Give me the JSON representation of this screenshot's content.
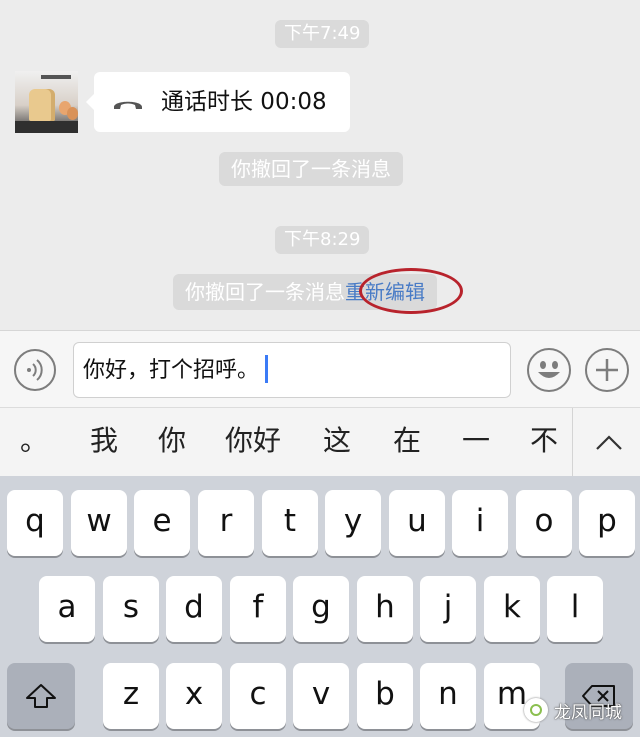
{
  "chat": {
    "time1": "下午7:49",
    "call_text": "通话时长 00:08",
    "recall1": "你撤回了一条消息",
    "time2": "下午8:29",
    "recall2": "你撤回了一条消息",
    "reedit_label": "重新编辑",
    "highlight_color": "#b8232c",
    "link_color": "#4a7cc6"
  },
  "input": {
    "value": "你好，打个招呼。",
    "voice_icon": "voice-icon",
    "emoji_icon": "emoji-icon",
    "plus_icon": "plus-icon"
  },
  "candidates": {
    "items": [
      "。",
      "我",
      "你",
      "你好",
      "这",
      "在",
      "一",
      "不"
    ],
    "expand_icon": "chevron-up-icon"
  },
  "keyboard": {
    "row1": [
      "q",
      "w",
      "e",
      "r",
      "t",
      "y",
      "u",
      "i",
      "o",
      "p"
    ],
    "row2": [
      "a",
      "s",
      "d",
      "f",
      "g",
      "h",
      "j",
      "k",
      "l"
    ],
    "row3": [
      "z",
      "x",
      "c",
      "v",
      "b",
      "n",
      "m"
    ],
    "shift_icon": "shift-icon",
    "delete_icon": "delete-icon"
  },
  "watermark": {
    "text": "龙凤同城"
  }
}
